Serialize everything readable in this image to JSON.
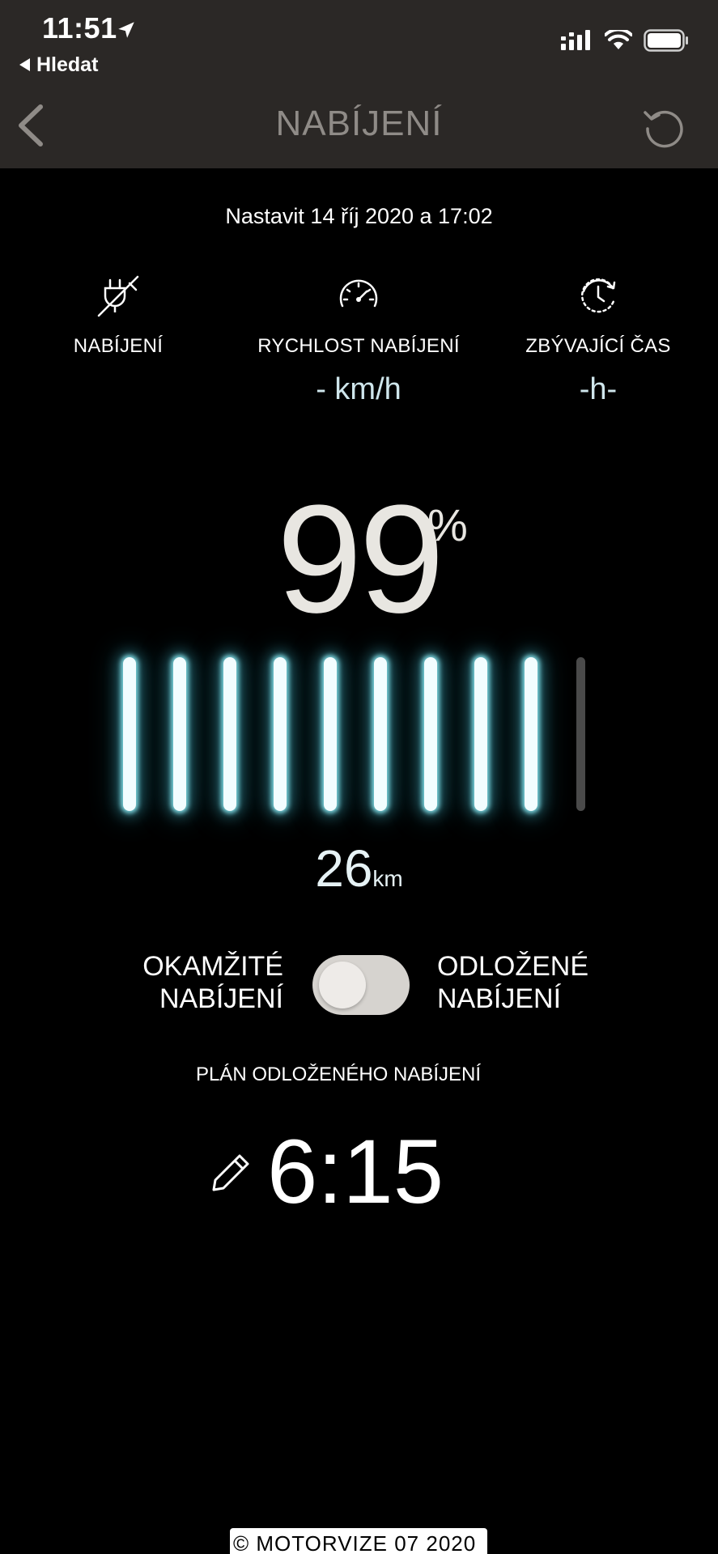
{
  "status_bar": {
    "time": "11:51",
    "back_app_label": "Hledat",
    "icons": [
      "location-arrow-icon",
      "cellular-signal-icon",
      "wifi-icon",
      "battery-icon"
    ]
  },
  "nav": {
    "title": "NABÍJENÍ",
    "back_icon": "chevron-left-icon",
    "refresh_icon": "refresh-icon"
  },
  "charging": {
    "set_date": "Nastavit 14 říj 2020 a 17:02",
    "info": [
      {
        "icon": "plug-off-icon",
        "label": "NABÍJENÍ",
        "value": ""
      },
      {
        "icon": "speedometer-icon",
        "label": "RYCHLOST NABÍJENÍ",
        "value": "- km/h"
      },
      {
        "icon": "clock-remaining-icon",
        "label": "ZBÝVAJÍCÍ ČAS",
        "value": "-h-"
      }
    ],
    "battery_percent": "99",
    "percent_sign": "%",
    "battery_bars_total": 10,
    "battery_bars_lit": 9,
    "range_value": "26",
    "range_unit": "km"
  },
  "mode": {
    "left_line1": "OKAMŽITÉ",
    "left_line2": "NABÍJENÍ",
    "right_line1": "ODLOŽENÉ",
    "right_line2": "NABÍJENÍ",
    "toggle_state": "off"
  },
  "plan": {
    "label": "PLÁN ODLOŽENÉHO NABÍJENÍ",
    "time": "6:15",
    "edit_icon": "pencil-icon"
  },
  "watermark": {
    "text": "© MOTORVIZE 07 2020"
  },
  "colors": {
    "topbar": "#2b2826",
    "background": "#000000",
    "bar_glow": "#8cebf5",
    "title_gray": "#8f8b87"
  }
}
